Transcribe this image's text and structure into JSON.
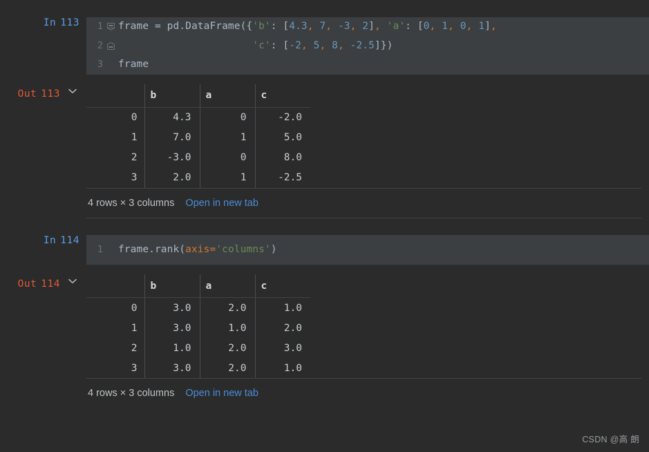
{
  "theme": {
    "page_background": "#2b2b2b",
    "code_cell_background": "#3c3f41",
    "in_prompt_color": "#5c9ce6",
    "out_prompt_color": "#e05a34",
    "link_color": "#4b8dda",
    "string_token_color": "#6a8759",
    "number_token_color": "#6897bb",
    "punctuation_token_color": "#cc7832",
    "default_text_color": "#a9b7c6"
  },
  "cells": [
    {
      "id": "cell-113",
      "input": {
        "prompt_label": "In",
        "prompt_number": "113",
        "line_numbers": [
          "1",
          "2",
          "3"
        ],
        "lines": [
          "frame = pd.DataFrame({'b': [4.3, 7, -3, 2], 'a': [0, 1, 0, 1],",
          "                      'c': [-2, 5, 8, -2.5]})",
          "frame"
        ]
      },
      "output": {
        "prompt_label": "Out",
        "prompt_number": "113",
        "collapse_icon": "chevron-down-icon",
        "table": {
          "index_header": "",
          "columns": [
            "b",
            "a",
            "c"
          ],
          "index": [
            "0",
            "1",
            "2",
            "3"
          ],
          "rows": [
            [
              "4.3",
              "0",
              "-2.0"
            ],
            [
              "7.0",
              "1",
              "5.0"
            ],
            [
              "-3.0",
              "0",
              "8.0"
            ],
            [
              "2.0",
              "1",
              "-2.5"
            ]
          ]
        },
        "footer": {
          "summary": "4 rows × 3 columns",
          "link_label": "Open in new tab"
        }
      }
    },
    {
      "id": "cell-114",
      "input": {
        "prompt_label": "In",
        "prompt_number": "114",
        "line_numbers": [
          "1"
        ],
        "lines": [
          "frame.rank(axis='columns')"
        ]
      },
      "output": {
        "prompt_label": "Out",
        "prompt_number": "114",
        "collapse_icon": "chevron-down-icon",
        "table": {
          "index_header": "",
          "columns": [
            "b",
            "a",
            "c"
          ],
          "index": [
            "0",
            "1",
            "2",
            "3"
          ],
          "rows": [
            [
              "3.0",
              "2.0",
              "1.0"
            ],
            [
              "3.0",
              "1.0",
              "2.0"
            ],
            [
              "1.0",
              "2.0",
              "3.0"
            ],
            [
              "3.0",
              "2.0",
              "1.0"
            ]
          ]
        },
        "footer": {
          "summary": "4 rows × 3 columns",
          "link_label": "Open in new tab"
        }
      }
    }
  ],
  "watermark": {
    "text": "CSDN @高 朗"
  }
}
